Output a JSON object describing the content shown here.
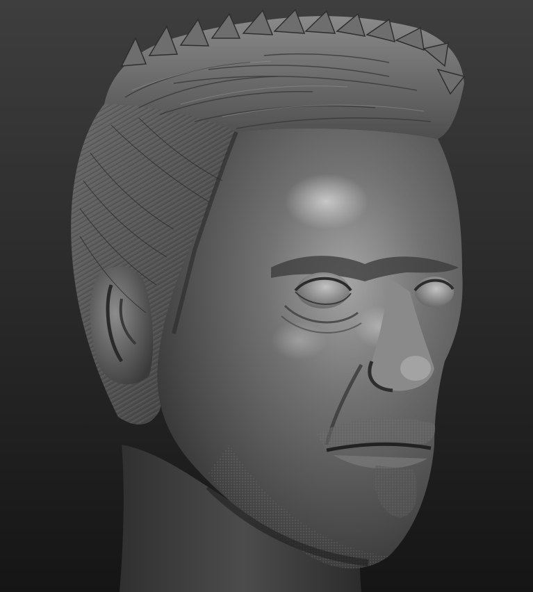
{
  "scene": {
    "subject": "sculpted-male-head-bust",
    "material": "matcap-gray-clay",
    "background": {
      "top_color": "#3c3c3c",
      "bottom_color": "#141414"
    },
    "clay_colors": {
      "highlight": "#9a9a9a",
      "base": "#5e5e5e",
      "shadow": "#2c2c2c",
      "deep_shadow": "#1e1e1e"
    }
  }
}
